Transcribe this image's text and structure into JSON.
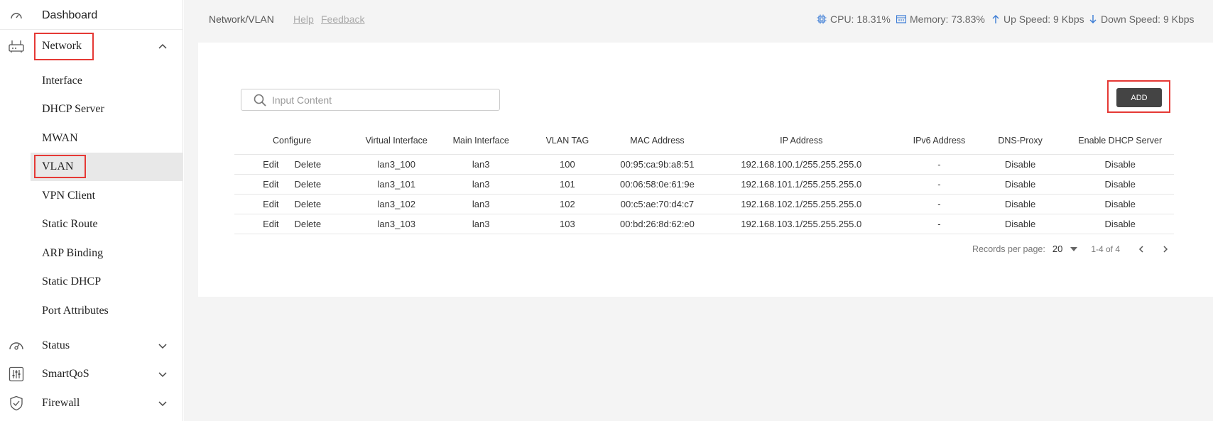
{
  "sidebar": {
    "dashboard": "Dashboard",
    "network": "Network",
    "network_items": [
      "Interface",
      "DHCP Server",
      "MWAN",
      "VLAN",
      "VPN Client",
      "Static Route",
      "ARP Binding",
      "Static DHCP",
      "Port Attributes"
    ],
    "status": "Status",
    "smartqos": "SmartQoS",
    "firewall": "Firewall"
  },
  "header": {
    "breadcrumb": "Network/VLAN",
    "help": "Help",
    "feedback": "Feedback",
    "cpu": "CPU: 18.31%",
    "memory": "Memory: 73.83%",
    "up_speed": "Up Speed: 9 Kbps",
    "down_speed": "Down Speed: 9 Kbps"
  },
  "search": {
    "placeholder": "Input Content"
  },
  "add_label": "ADD",
  "table": {
    "columns": [
      "Configure",
      "Virtual Interface",
      "Main Interface",
      "VLAN TAG",
      "MAC Address",
      "IP Address",
      "IPv6 Address",
      "DNS-Proxy",
      "Enable DHCP Server"
    ],
    "rows": [
      {
        "edit": "Edit",
        "delete": "Delete",
        "virtual": "lan3_100",
        "main": "lan3",
        "tag": "100",
        "mac": "00:95:ca:9b:a8:51",
        "ip": "192.168.100.1/255.255.255.0",
        "ipv6": "-",
        "dns": "Disable",
        "dhcp": "Disable"
      },
      {
        "edit": "Edit",
        "delete": "Delete",
        "virtual": "lan3_101",
        "main": "lan3",
        "tag": "101",
        "mac": "00:06:58:0e:61:9e",
        "ip": "192.168.101.1/255.255.255.0",
        "ipv6": "-",
        "dns": "Disable",
        "dhcp": "Disable"
      },
      {
        "edit": "Edit",
        "delete": "Delete",
        "virtual": "lan3_102",
        "main": "lan3",
        "tag": "102",
        "mac": "00:c5:ae:70:d4:c7",
        "ip": "192.168.102.1/255.255.255.0",
        "ipv6": "-",
        "dns": "Disable",
        "dhcp": "Disable"
      },
      {
        "edit": "Edit",
        "delete": "Delete",
        "virtual": "lan3_103",
        "main": "lan3",
        "tag": "103",
        "mac": "00:bd:26:8d:62:e0",
        "ip": "192.168.103.1/255.255.255.0",
        "ipv6": "-",
        "dns": "Disable",
        "dhcp": "Disable"
      }
    ]
  },
  "pager": {
    "label": "Records per page:",
    "per_page": "20",
    "range": "1-4 of 4"
  },
  "colors": {
    "accent_blue": "#3a7bd5",
    "highlight_red": "#e53935",
    "button_dark": "#444444"
  }
}
